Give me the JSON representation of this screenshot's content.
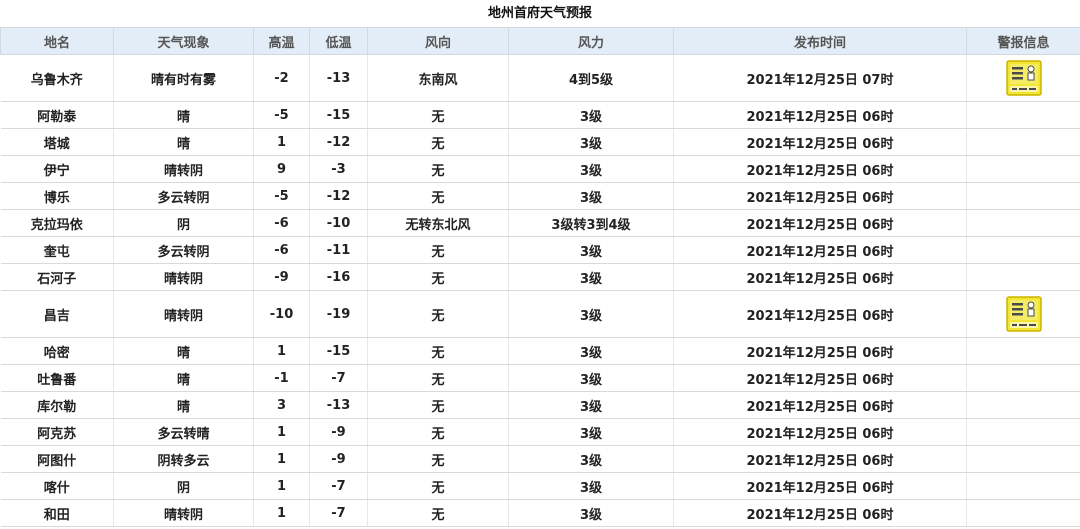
{
  "title": "地州首府天气预报",
  "columns": [
    "地名",
    "天气现象",
    "高温",
    "低温",
    "风向",
    "风力",
    "发布时间",
    "警报信息"
  ],
  "colors": {
    "header_bg": "#e3edf7",
    "warning_yellow": "#f2e633",
    "warning_border": "#c8b400"
  },
  "rows": [
    {
      "city": "乌鲁木齐",
      "weather": "晴有时有雾",
      "high": "-2",
      "low": "-13",
      "wind_dir": "东南风",
      "wind_force": "4到5级",
      "time": "2021年12月25日 07时",
      "warning": "yellow-warning-icon"
    },
    {
      "city": "阿勒泰",
      "weather": "晴",
      "high": "-5",
      "low": "-15",
      "wind_dir": "无",
      "wind_force": "3级",
      "time": "2021年12月25日 06时",
      "warning": ""
    },
    {
      "city": "塔城",
      "weather": "晴",
      "high": "1",
      "low": "-12",
      "wind_dir": "无",
      "wind_force": "3级",
      "time": "2021年12月25日 06时",
      "warning": ""
    },
    {
      "city": "伊宁",
      "weather": "晴转阴",
      "high": "9",
      "low": "-3",
      "wind_dir": "无",
      "wind_force": "3级",
      "time": "2021年12月25日 06时",
      "warning": ""
    },
    {
      "city": "博乐",
      "weather": "多云转阴",
      "high": "-5",
      "low": "-12",
      "wind_dir": "无",
      "wind_force": "3级",
      "time": "2021年12月25日 06时",
      "warning": ""
    },
    {
      "city": "克拉玛依",
      "weather": "阴",
      "high": "-6",
      "low": "-10",
      "wind_dir": "无转东北风",
      "wind_force": "3级转3到4级",
      "time": "2021年12月25日 06时",
      "warning": ""
    },
    {
      "city": "奎屯",
      "weather": "多云转阴",
      "high": "-6",
      "low": "-11",
      "wind_dir": "无",
      "wind_force": "3级",
      "time": "2021年12月25日 06时",
      "warning": ""
    },
    {
      "city": "石河子",
      "weather": "晴转阴",
      "high": "-9",
      "low": "-16",
      "wind_dir": "无",
      "wind_force": "3级",
      "time": "2021年12月25日 06时",
      "warning": ""
    },
    {
      "city": "昌吉",
      "weather": "晴转阴",
      "high": "-10",
      "low": "-19",
      "wind_dir": "无",
      "wind_force": "3级",
      "time": "2021年12月25日 06时",
      "warning": "yellow-warning-icon"
    },
    {
      "city": "哈密",
      "weather": "晴",
      "high": "1",
      "low": "-15",
      "wind_dir": "无",
      "wind_force": "3级",
      "time": "2021年12月25日 06时",
      "warning": ""
    },
    {
      "city": "吐鲁番",
      "weather": "晴",
      "high": "-1",
      "low": "-7",
      "wind_dir": "无",
      "wind_force": "3级",
      "time": "2021年12月25日 06时",
      "warning": ""
    },
    {
      "city": "库尔勒",
      "weather": "晴",
      "high": "3",
      "low": "-13",
      "wind_dir": "无",
      "wind_force": "3级",
      "time": "2021年12月25日 06时",
      "warning": ""
    },
    {
      "city": "阿克苏",
      "weather": "多云转晴",
      "high": "1",
      "low": "-9",
      "wind_dir": "无",
      "wind_force": "3级",
      "time": "2021年12月25日 06时",
      "warning": ""
    },
    {
      "city": "阿图什",
      "weather": "阴转多云",
      "high": "1",
      "low": "-9",
      "wind_dir": "无",
      "wind_force": "3级",
      "time": "2021年12月25日 06时",
      "warning": ""
    },
    {
      "city": "喀什",
      "weather": "阴",
      "high": "1",
      "low": "-7",
      "wind_dir": "无",
      "wind_force": "3级",
      "time": "2021年12月25日 06时",
      "warning": ""
    },
    {
      "city": "和田",
      "weather": "晴转阴",
      "high": "1",
      "low": "-7",
      "wind_dir": "无",
      "wind_force": "3级",
      "time": "2021年12月25日 06时",
      "warning": ""
    }
  ]
}
